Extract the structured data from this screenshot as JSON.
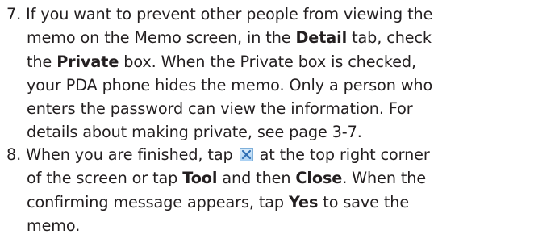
{
  "step7": {
    "number": "7.",
    "line1": "If you want to prevent other people from viewing the",
    "line2": "memo on the Memo screen, in the ",
    "detail": "Detail",
    "line2_end": " tab, check",
    "line3_start": "the ",
    "private": "Private",
    "line3_end": " box. When the Private box is checked,",
    "line4": "your PDA phone hides the memo. Only a person who",
    "line5": "enters the password can view the information. For",
    "line6": "details about making private, see page 3-7."
  },
  "step8": {
    "number": "8.",
    "line1_start": "When you are finished, tap ",
    "line1_end": " at the top right corner",
    "line2_start": "of the screen or tap ",
    "tool": "Tool",
    "line2_mid": " and then ",
    "close": "Close",
    "line2_end": ". When the",
    "line3": "confirming message appears, tap ",
    "yes": "Yes",
    "line3_end": " to save the",
    "line4": "memo."
  },
  "icons": {
    "close_icon": "close-x-icon",
    "icon_color": "#2f6fb5"
  }
}
